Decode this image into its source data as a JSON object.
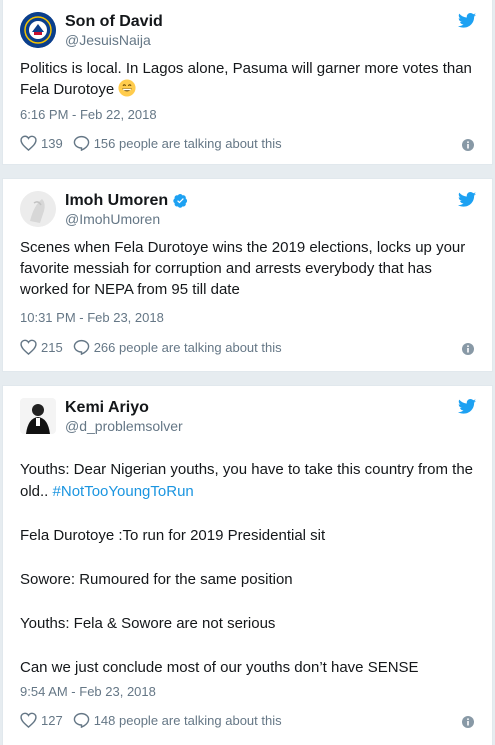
{
  "tweets": [
    {
      "name": "Son of David",
      "handle": "@JesuisNaija",
      "verified": false,
      "text": "Politics is local. In Lagos alone, Pasuma will garner more votes than Fela Durotoye",
      "emoji": "grinning-face-emoji",
      "timestamp": "6:16 PM - Feb 22, 2018",
      "likes": "139",
      "talking": "156 people are talking about this"
    },
    {
      "name": "Imoh Umoren",
      "handle": "@ImohUmoren",
      "verified": true,
      "text": "Scenes when Fela Durotoye wins the 2019 elections, locks up your favorite messiah for corruption and arrests everybody that has worked for NEPA from 95 till date",
      "timestamp": "10:31 PM - Feb 23, 2018",
      "likes": "215",
      "talking": "266 people are talking about this"
    },
    {
      "name": "Kemi Ariyo",
      "handle": "@d_problemsolver",
      "verified": false,
      "text_lines": {
        "p1a": "Youths: Dear Nigerian youths, you have to take this country from the old.. ",
        "p1b": "#NotTooYoungToRun",
        "p2": "Fela Durotoye :To run for 2019 Presidential sit",
        "p3": "Sowore: Rumoured for the same position",
        "p4": "Youths: Fela & Sowore are not serious",
        "p5": "Can we just conclude most of our youths don’t have SENSE"
      },
      "timestamp": "9:54 AM - Feb 23, 2018",
      "likes": "127",
      "talking": "148 people are talking about this"
    }
  ],
  "colors": {
    "twitter_blue": "#1da1f2",
    "hashtag": "#1b95e0",
    "secondary_text": "#657786",
    "background": "#e6ecf0"
  }
}
